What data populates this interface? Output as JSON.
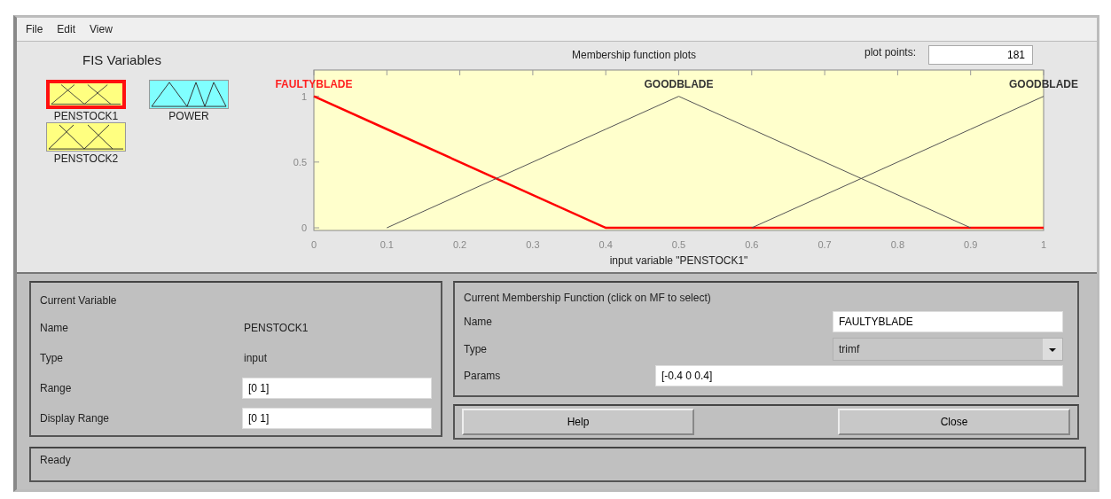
{
  "menu": [
    "File",
    "Edit",
    "View"
  ],
  "fis_variables": {
    "title": "FIS Variables",
    "items": [
      {
        "name": "PENSTOCK1",
        "kind": "input",
        "selected": true
      },
      {
        "name": "POWER",
        "kind": "output",
        "selected": false
      },
      {
        "name": "PENSTOCK2",
        "kind": "input",
        "selected": false
      }
    ]
  },
  "plot": {
    "title": "Membership function plots",
    "plot_points_label": "plot points:",
    "plot_points": "181",
    "chart_data": {
      "type": "line",
      "xlabel": "input variable \"PENSTOCK1\"",
      "x": [
        0,
        0.1,
        0.4,
        0.5,
        0.6,
        0.9,
        1
      ],
      "xlim": [
        0,
        1
      ],
      "ylim": [
        -0.02,
        1.2
      ],
      "xticks": [
        0,
        0.1,
        0.2,
        0.3,
        0.4,
        0.5,
        0.6,
        0.7,
        0.8,
        0.9,
        1
      ],
      "yticks": [
        0,
        0.5,
        1
      ],
      "series": [
        {
          "name": "FAULTYBLADE",
          "color": "#ff0000",
          "values": [
            1,
            0.75,
            0,
            0,
            0,
            0,
            0
          ]
        },
        {
          "name": "GOODBLADE",
          "color": "#555555",
          "values": [
            null,
            0,
            0.75,
            1,
            0.75,
            0,
            null
          ]
        },
        {
          "name": "GOODBLADE",
          "color": "#555555",
          "values": [
            null,
            null,
            null,
            null,
            0,
            0.75,
            1
          ]
        }
      ]
    }
  },
  "current_variable": {
    "title": "Current Variable",
    "name_label": "Name",
    "name": "PENSTOCK1",
    "type_label": "Type",
    "type": "input",
    "range_label": "Range",
    "range": "[0 1]",
    "display_range_label": "Display Range",
    "display_range": "[0 1]"
  },
  "current_mf": {
    "title": "Current Membership Function (click on MF to select)",
    "name_label": "Name",
    "name": "FAULTYBLADE",
    "type_label": "Type",
    "type": "trimf",
    "params_label": "Params",
    "params": "[-0.4 0 0.4]"
  },
  "buttons": [
    "Help",
    "Close"
  ],
  "status_bar": "Ready"
}
